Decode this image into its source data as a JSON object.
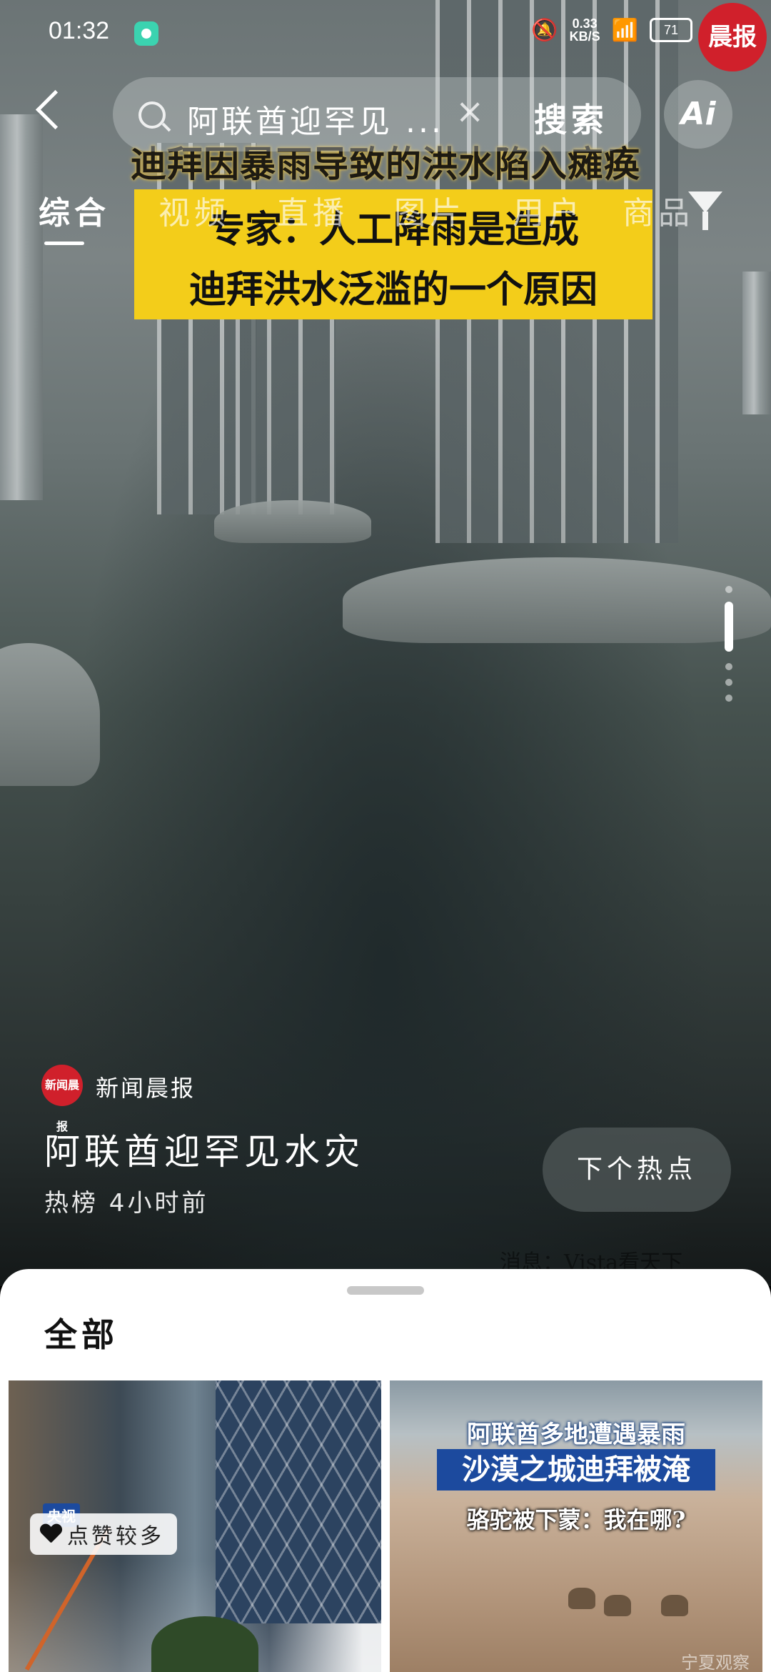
{
  "status_bar": {
    "time": "01:32",
    "speed_value": "0.33",
    "speed_unit": "KB/S",
    "battery": "71",
    "corner_badge": "晨报"
  },
  "search": {
    "query": "阿联酋迎罕见 ...",
    "clear_glyph": "×",
    "button_label": "搜索",
    "ai_label": "Ai"
  },
  "tabs": [
    {
      "label": "综合"
    },
    {
      "label": "视频"
    },
    {
      "label": "直播"
    },
    {
      "label": "图片"
    },
    {
      "label": "用户"
    },
    {
      "label": "商品"
    }
  ],
  "video": {
    "title_line": "迪拜因暴雨导致的洪水陷入瘫痪",
    "box_line1": "专家：人工降雨是造成",
    "box_line2": "迪拜洪水泛滥的一个原因",
    "source_watermark": "消息：Vista看天下"
  },
  "post": {
    "author_name": "新闻晨报",
    "author_avatar_text": "新闻晨报",
    "title": "阿联酋迎罕见水灾",
    "meta": "热榜 4小时前",
    "next_button": "下个热点"
  },
  "sheet": {
    "title": "全部",
    "cards": [
      {
        "tag": "央视",
        "like_badge": "点赞较多"
      },
      {
        "line1": "阿联酋多地遭遇暴雨",
        "line2": "沙漠之城迪拜被淹",
        "line3": "骆驼被下蒙：我在哪?",
        "mark": "宁夏观察"
      }
    ]
  },
  "icons": [
    "back-arrow-icon",
    "search-icon",
    "clear-icon",
    "ai-icon",
    "filter-icon",
    "heart-icon",
    "wifi-icon",
    "mute-icon"
  ]
}
